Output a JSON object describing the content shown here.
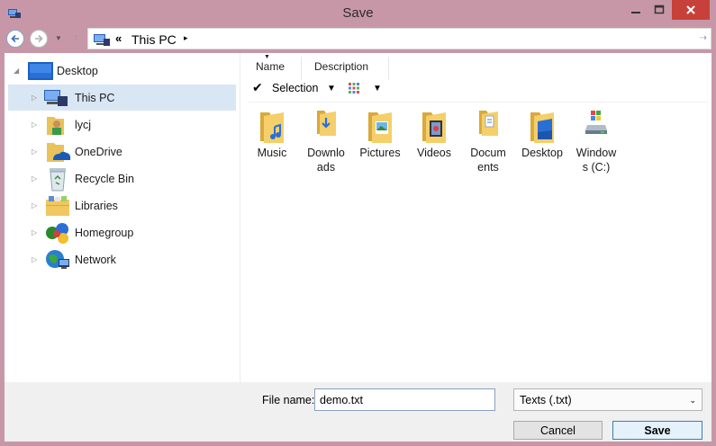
{
  "window": {
    "title": "Save",
    "accent": "#c797a8",
    "close_color": "#c7413a"
  },
  "nav": {
    "back_icon": "back-arrow-icon",
    "forward_icon": "forward-arrow-icon",
    "address_separator": "«",
    "address_path": "This PC",
    "address_chevron": "▸"
  },
  "tree": {
    "items": [
      {
        "label": "Desktop",
        "icon": "desktop-icon",
        "expanded": true
      },
      {
        "label": "This PC",
        "icon": "this-pc-icon",
        "selected": true
      },
      {
        "label": "lycj",
        "icon": "user-folder-icon"
      },
      {
        "label": "OneDrive",
        "icon": "onedrive-icon"
      },
      {
        "label": "Recycle Bin",
        "icon": "recycle-bin-icon"
      },
      {
        "label": "Libraries",
        "icon": "libraries-icon"
      },
      {
        "label": "Homegroup",
        "icon": "homegroup-icon"
      },
      {
        "label": "Network",
        "icon": "network-icon"
      }
    ]
  },
  "content": {
    "columns": [
      "Name",
      "Description"
    ],
    "selection_label": "Selection",
    "files": [
      {
        "label": "Music",
        "icon": "music-folder-icon"
      },
      {
        "label": "Downlo ads",
        "icon": "downloads-folder-icon"
      },
      {
        "label": "Pictures",
        "icon": "pictures-folder-icon"
      },
      {
        "label": "Videos",
        "icon": "videos-folder-icon"
      },
      {
        "label": "Docum ents",
        "icon": "documents-folder-icon"
      },
      {
        "label": "Desktop",
        "icon": "desktop-folder-icon"
      },
      {
        "label": "Window s (C:)",
        "icon": "drive-c-icon"
      }
    ]
  },
  "bottom": {
    "file_name_label": "File name:",
    "file_name_value": "demo.txt",
    "file_type_value": "Texts (.txt)",
    "cancel_label": "Cancel",
    "save_label": "Save"
  }
}
